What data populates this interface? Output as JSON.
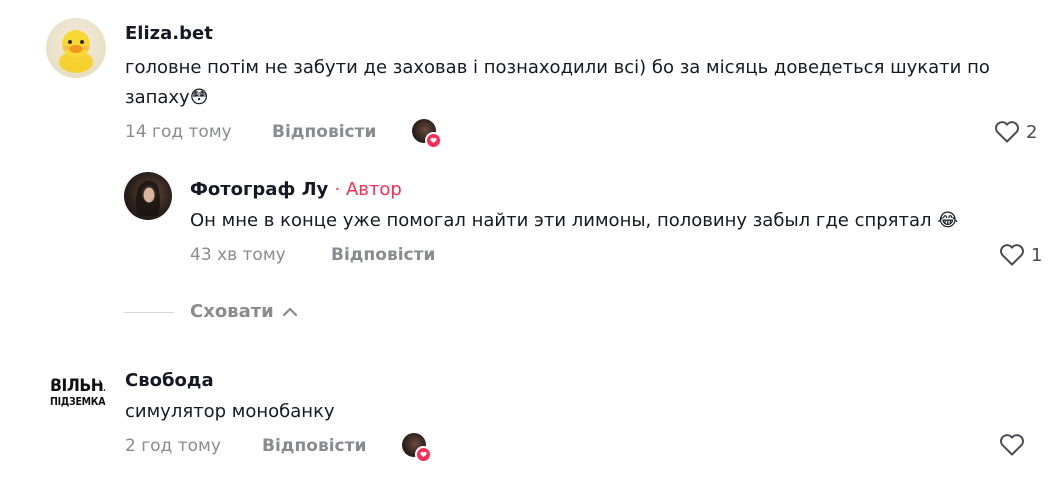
{
  "comments": [
    {
      "username": "Eliza.bet",
      "text_line1": "головне потім не забути де заховав і познаходили всі) бо за місяць доведеться шукати по",
      "text_line2": "запаху",
      "text_emoji": "😳",
      "time": "14 год тому",
      "reply_label": "Відповісти",
      "likes": "2",
      "avatar_icon": "duck-avatar"
    },
    {
      "username": "Фотограф Лу",
      "author_tag": "· Автор",
      "text": "Он мне в конце уже помогал найти эти лимоны, половину забыл где спрятал",
      "text_emoji": "😂",
      "time": "43 хв тому",
      "reply_label": "Відповісти",
      "likes": "1",
      "avatar_icon": "photo-avatar"
    },
    {
      "username": "Свобода",
      "text": "симулятор монобанку",
      "time": "2 год тому",
      "reply_label": "Відповісти",
      "likes": "",
      "avatar_logo_line1": "ВІЛЬНА",
      "avatar_logo_line2": "ПІДЗЕМКА"
    }
  ],
  "hide_label": "Сховати",
  "colors": {
    "accent": "#fe2c55",
    "muted": "#8a8b91",
    "text": "#161823"
  }
}
